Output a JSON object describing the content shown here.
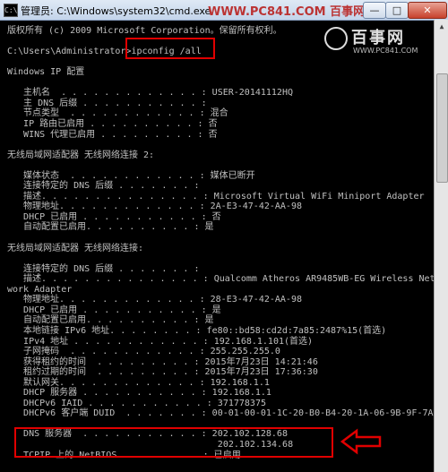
{
  "window": {
    "title": "管理员: C:\\Windows\\system32\\cmd.exe",
    "header_brand": "WWW.PC841.COM 百事网",
    "min_label": "—",
    "max_label": "□",
    "close_label": "✕"
  },
  "watermark": {
    "name": "百事网",
    "url": "WWW.PC841.COM"
  },
  "console": {
    "lines": [
      "版权所有 (c) 2009 Microsoft Corporation。保留所有权利。",
      "",
      "C:\\Users\\Administrator>ipconfig /all",
      "",
      "Windows IP 配置",
      "",
      "   主机名  . . . . . . . . . . . . . : USER-20141112HQ",
      "   主 DNS 后缀 . . . . . . . . . . . :",
      "   节点类型  . . . . . . . . . . . . : 混合",
      "   IP 路由已启用 . . . . . . . . . . : 否",
      "   WINS 代理已启用 . . . . . . . . . : 否",
      "",
      "无线局域网适配器 无线网络连接 2:",
      "",
      "   媒体状态  . . . . . . . . . . . . : 媒体已断开",
      "   连接特定的 DNS 后缀 . . . . . . . :",
      "   描述. . . . . . . . . . . . . . . : Microsoft Virtual WiFi Miniport Adapter",
      "   物理地址. . . . . . . . . . . . . : 2A-E3-47-42-AA-98",
      "   DHCP 已启用 . . . . . . . . . . . : 否",
      "   自动配置已启用. . . . . . . . . . : 是",
      "",
      "无线局域网适配器 无线网络连接:",
      "",
      "   连接特定的 DNS 后缀 . . . . . . . :",
      "   描述. . . . . . . . . . . . . . . : Qualcomm Atheros AR9485WB-EG Wireless Net",
      "work Adapter",
      "   物理地址. . . . . . . . . . . . . : 28-E3-47-42-AA-98",
      "   DHCP 已启用 . . . . . . . . . . . : 是",
      "   自动配置已启用. . . . . . . . . . : 是",
      "   本地链接 IPv6 地址. . . . . . . . : fe80::bd58:cd2d:7a85:2487%15(首选)",
      "   IPv4 地址 . . . . . . . . . . . . : 192.168.1.101(首选)",
      "   子网掩码  . . . . . . . . . . . . : 255.255.255.0",
      "   获得租约的时间  . . . . . . . . . : 2015年7月23日 14:21:46",
      "   租约过期的时间  . . . . . . . . . : 2015年7月23日 17:36:30",
      "   默认网关. . . . . . . . . . . . . : 192.168.1.1",
      "   DHCP 服务器 . . . . . . . . . . . : 192.168.1.1",
      "   DHCPv6 IAID . . . . . . . . . . . : 371778375",
      "   DHCPv6 客户端 DUID  . . . . . . . : 00-01-00-01-1C-20-B0-B4-20-1A-06-9B-9F-7A",
      "",
      "   DNS 服务器  . . . . . . . . . . . : 202.102.128.68",
      "                                       202.102.134.68",
      "   TCPIP 上的 NetBIOS  . . . . . . . : 已启用"
    ]
  },
  "annotations": {
    "arrow_color": "#e00000",
    "box_color": "#e00000"
  }
}
